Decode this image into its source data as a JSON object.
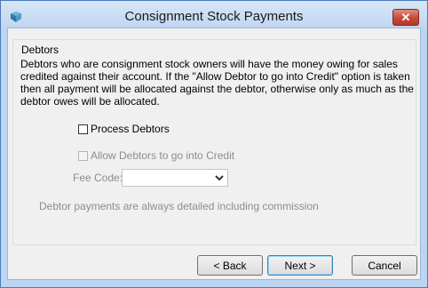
{
  "window": {
    "title": "Consignment Stock Payments",
    "close_glyph": "✕"
  },
  "group": {
    "label": "Debtors",
    "description": "Debtors who are consignment stock owners will have the money owing for sales credited against their account.  If the \"Allow Debtor to go into Credit\" option is taken then all payment will be allocated against the debtor, otherwise only as much as the debtor owes will be allocated.",
    "process_debtors": {
      "label": "Process Debtors",
      "checked": false
    },
    "allow_credit": {
      "label": "Allow Debtors to go into Credit",
      "checked": false,
      "enabled": false
    },
    "fee_code": {
      "label": "Fee Code:",
      "value": "",
      "enabled": false
    },
    "note": "Debtor payments are always detailed including commission"
  },
  "buttons": {
    "back": "< Back",
    "next": "Next >",
    "cancel": "Cancel"
  },
  "icons": {
    "app": "app-arrow-icon",
    "dropdown": "chevron-down-icon",
    "close": "close-icon"
  },
  "colors": {
    "titlebar": "#bcd4f0",
    "client": "#f0f0f0",
    "close": "#c44a3a",
    "disabled_text": "#8d8d8d"
  }
}
